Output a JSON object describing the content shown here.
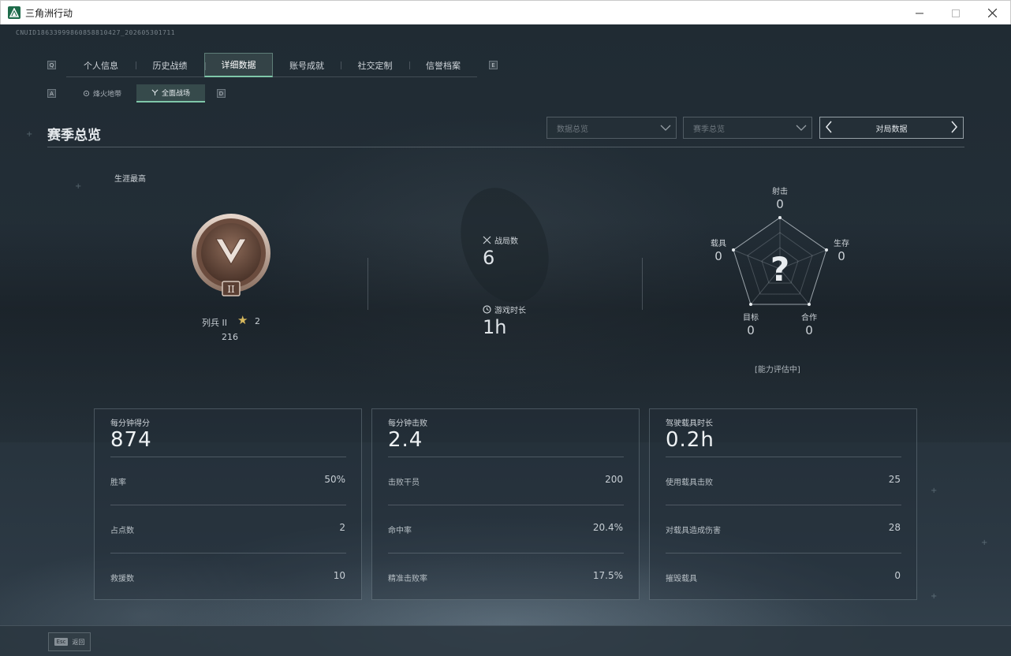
{
  "window": {
    "title": "三角洲行动",
    "controls": [
      "minimize",
      "maximize",
      "close"
    ]
  },
  "uid": "CNUID18633999860858810427_202605301711",
  "nav": {
    "prev_key": "Q",
    "next_key": "E",
    "tabs": [
      {
        "label": "个人信息",
        "active": false
      },
      {
        "label": "历史战绩",
        "active": false
      },
      {
        "label": "详细数据",
        "active": true
      },
      {
        "label": "账号成就",
        "active": false
      },
      {
        "label": "社交定制",
        "active": false
      },
      {
        "label": "信誉档案",
        "active": false
      }
    ]
  },
  "subnav": {
    "prev_key": "A",
    "next_key": "D",
    "tabs": [
      {
        "label": "烽火地带",
        "icon": "mode-icon",
        "active": false
      },
      {
        "label": "全面战场",
        "icon": "battlefield-icon",
        "active": true
      }
    ]
  },
  "section": {
    "title": "赛季总览",
    "dropdown_data": "数据总览",
    "dropdown_season": "赛季总览",
    "pager_label": "对局数据"
  },
  "career": {
    "label": "生涯最高",
    "rank_name": "列兵 II",
    "rank_numeral": "II",
    "stars": "2",
    "points": "216"
  },
  "match_stats": {
    "matches_label": "战局数",
    "matches_value": "6",
    "time_label": "游戏时长",
    "time_value": "1h"
  },
  "radar": {
    "shooting": {
      "label": "射击",
      "value": "0"
    },
    "survival": {
      "label": "生存",
      "value": "0"
    },
    "cooperation": {
      "label": "合作",
      "value": "0"
    },
    "objective": {
      "label": "目标",
      "value": "0"
    },
    "vehicle": {
      "label": "载具",
      "value": "0"
    },
    "center_symbol": "?",
    "status": "[能力评估中]"
  },
  "cards": [
    {
      "head_label": "每分钟得分",
      "head_value": "874",
      "rows": [
        {
          "label": "胜率",
          "value": "50%"
        },
        {
          "label": "占点数",
          "value": "2"
        },
        {
          "label": "救援数",
          "value": "10"
        }
      ]
    },
    {
      "head_label": "每分钟击败",
      "head_value": "2.4",
      "rows": [
        {
          "label": "击败干员",
          "value": "200"
        },
        {
          "label": "命中率",
          "value": "20.4%"
        },
        {
          "label": "精准击败率",
          "value": "17.5%"
        }
      ]
    },
    {
      "head_label": "驾驶载具时长",
      "head_value": "0.2h",
      "rows": [
        {
          "label": "使用载具击败",
          "value": "25"
        },
        {
          "label": "对载具造成伤害",
          "value": "28"
        },
        {
          "label": "摧毁载具",
          "value": "0"
        }
      ]
    }
  ],
  "bottom": {
    "esc_key": "Esc",
    "back_label": "返回"
  },
  "colors": {
    "accent": "#7fc7a9",
    "star": "#d7b85d",
    "background": "#1c252d"
  }
}
